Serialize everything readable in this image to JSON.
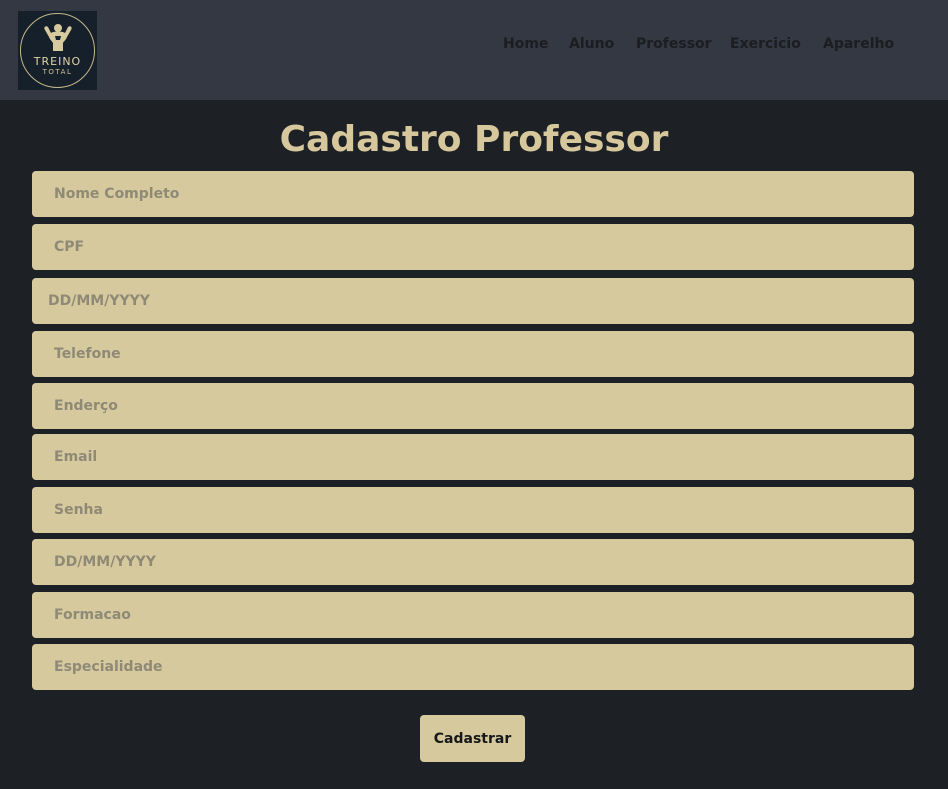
{
  "brand": {
    "name": "TREINO",
    "subname": "TOTAL"
  },
  "nav": [
    "Home",
    "Aluno",
    "Professor",
    "Exercicio",
    "Aparelho"
  ],
  "page_title": "Cadastro Professor",
  "form": {
    "fields": [
      {
        "placeholder": "Nome Completo",
        "value": ""
      },
      {
        "placeholder": "CPF",
        "value": ""
      },
      {
        "placeholder": "DD/MM/YYYY",
        "value": ""
      },
      {
        "placeholder": "Telefone",
        "value": ""
      },
      {
        "placeholder": "Enderço",
        "value": ""
      },
      {
        "placeholder": "Email",
        "value": ""
      },
      {
        "placeholder": "Senha",
        "value": ""
      },
      {
        "placeholder": "DD/MM/YYYY",
        "value": ""
      },
      {
        "placeholder": "Formacao",
        "value": ""
      },
      {
        "placeholder": "Especialidade",
        "value": ""
      }
    ],
    "submit_label": "Cadastrar"
  },
  "colors": {
    "header_bg": "#343842",
    "page_bg": "#1d2024",
    "accent": "#d6c99d",
    "title": "#d6c89c"
  }
}
